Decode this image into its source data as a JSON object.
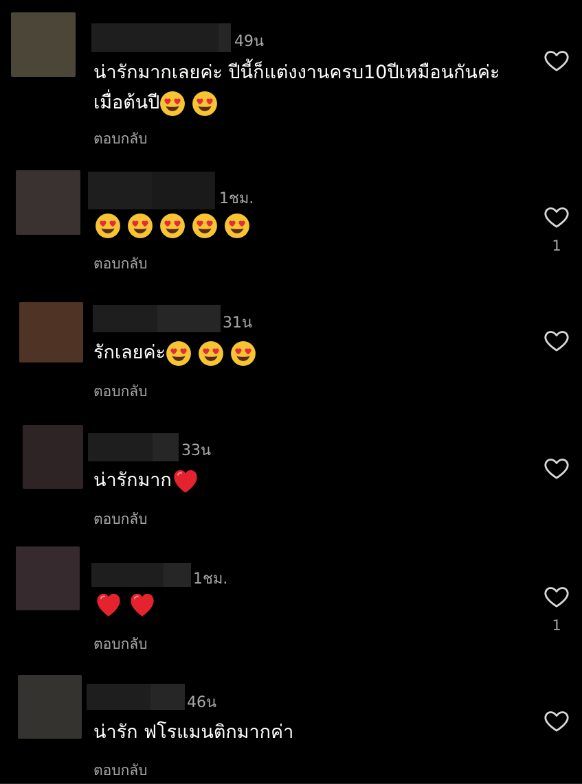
{
  "comments": [
    {
      "time": "49น",
      "text": "น่ารักมากเลยค่ะ ปีนี้ก็แต่งงานครบ10ปีเหมือนกันค่ะเมื่อต้นปี",
      "emojis": [
        "heart-eyes",
        "heart-eyes"
      ],
      "reply": "ตอบกลับ",
      "likes": "",
      "avatar_color": "#4c4638"
    },
    {
      "time": "1ชม.",
      "text": "",
      "emojis": [
        "heart-eyes",
        "heart-eyes",
        "heart-eyes",
        "heart-eyes",
        "heart-eyes"
      ],
      "reply": "ตอบกลับ",
      "likes": "1",
      "avatar_color": "#3a3230"
    },
    {
      "time": "31น",
      "text": "รักเลยค่ะ",
      "emojis": [
        "heart-eyes",
        "heart-eyes",
        "heart-eyes"
      ],
      "reply": "ตอบกลับ",
      "likes": "",
      "avatar_color": "#4f3426"
    },
    {
      "time": "33น",
      "text": "น่ารักมาก",
      "emojis": [
        "red-heart"
      ],
      "reply": "ตอบกลับ",
      "likes": "",
      "avatar_color": "#2f2425"
    },
    {
      "time": "1ชม.",
      "text": "",
      "emojis": [
        "red-heart",
        "red-heart"
      ],
      "reply": "ตอบกลับ",
      "likes": "1",
      "avatar_color": "#372a2e"
    },
    {
      "time": "46น",
      "text": "น่ารัก ฟโรแมนติกมากค่า",
      "emojis": [],
      "reply": "ตอบกลับ",
      "likes": "",
      "avatar_color": "#34332f"
    }
  ],
  "icons": {
    "like": "heart-outline-icon"
  },
  "colors": {
    "background": "#000000",
    "secondary_text": "#a8a8a8"
  }
}
